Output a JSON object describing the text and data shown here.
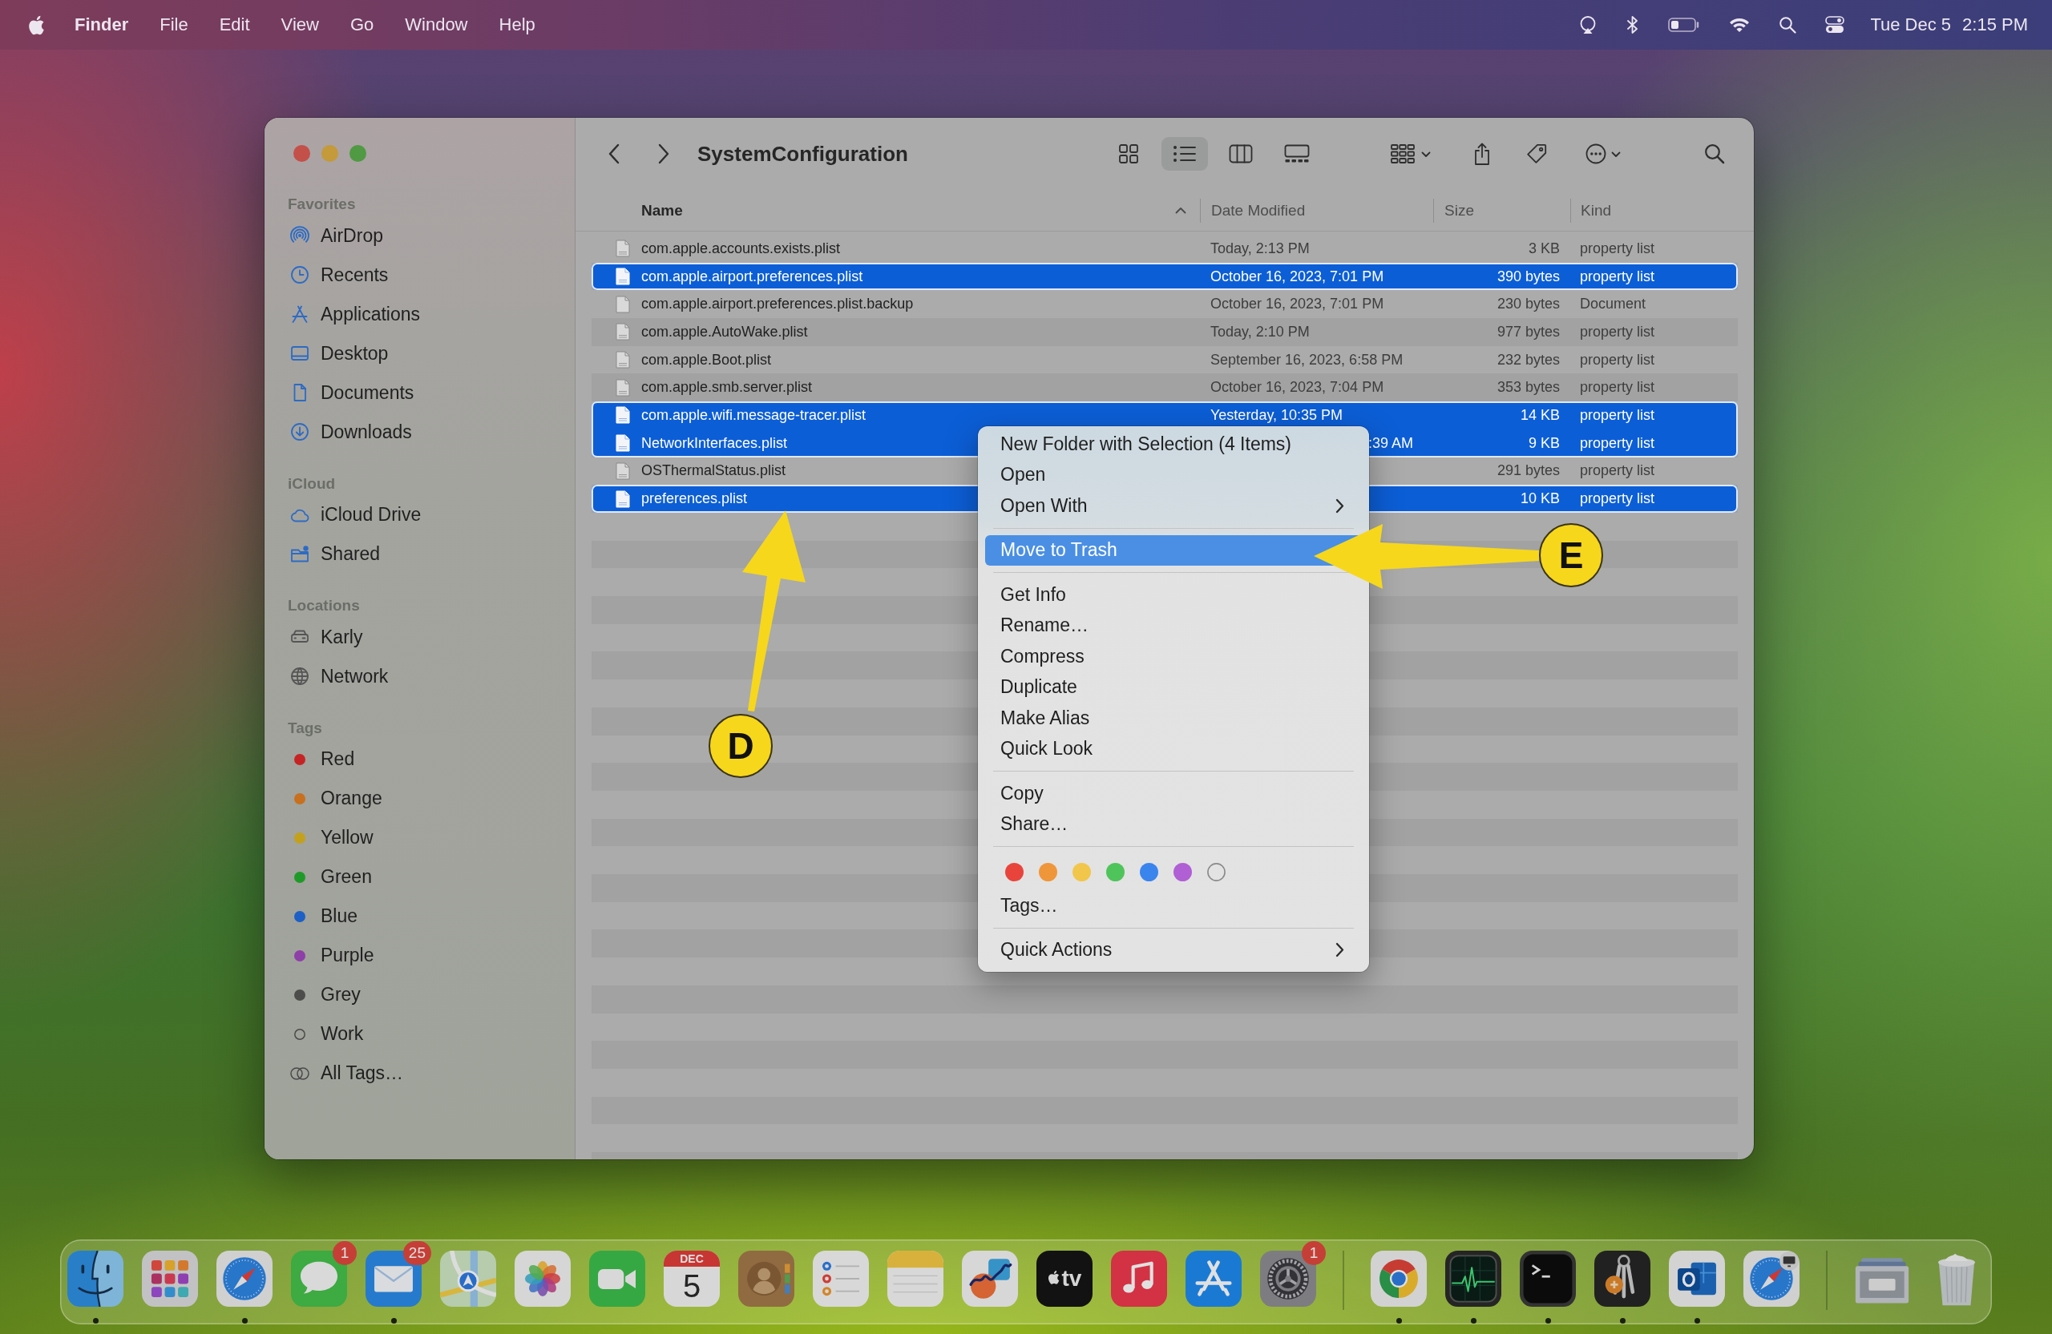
{
  "menu_bar": {
    "app_name": "Finder",
    "menus": [
      "File",
      "Edit",
      "View",
      "Go",
      "Window",
      "Help"
    ],
    "date": "Tue Dec 5",
    "time": "2:15 PM"
  },
  "window": {
    "title": "SystemConfiguration",
    "view_buttons": [
      {
        "kind": "icons",
        "selected": false
      },
      {
        "kind": "list",
        "selected": true
      },
      {
        "kind": "columns",
        "selected": false
      },
      {
        "kind": "gallery",
        "selected": false
      }
    ],
    "sidebar": [
      {
        "heading": "Favorites",
        "items": [
          {
            "label": "AirDrop"
          },
          {
            "label": "Recents"
          },
          {
            "label": "Applications"
          },
          {
            "label": "Desktop"
          },
          {
            "label": "Documents"
          },
          {
            "label": "Downloads"
          }
        ]
      },
      {
        "heading": "iCloud",
        "items": [
          {
            "label": "iCloud Drive"
          },
          {
            "label": "Shared"
          }
        ]
      },
      {
        "heading": "Locations",
        "items": [
          {
            "label": "Karly"
          },
          {
            "label": "Network"
          }
        ]
      },
      {
        "heading": "Tags",
        "items": [
          {
            "kind": "tag",
            "label": "Red",
            "color": "#c62424"
          },
          {
            "kind": "tag",
            "label": "Orange",
            "color": "#c8701e"
          },
          {
            "kind": "tag",
            "label": "Yellow",
            "color": "#c4a11c"
          },
          {
            "kind": "tag",
            "label": "Green",
            "color": "#1f9a28"
          },
          {
            "kind": "tag",
            "label": "Blue",
            "color": "#1d5fc6"
          },
          {
            "kind": "tag",
            "label": "Purple",
            "color": "#8e3fa8"
          },
          {
            "kind": "tag",
            "label": "Grey",
            "color": "#4d4d4b"
          },
          {
            "kind": "tag-empty",
            "label": "Work"
          },
          {
            "kind": "all-tags",
            "label": "All Tags…"
          }
        ]
      }
    ],
    "columns": [
      {
        "label": "Name",
        "sorted": true
      },
      {
        "label": "Date Modified",
        "sorted": false
      },
      {
        "label": "Size",
        "sorted": false
      },
      {
        "label": "Kind",
        "sorted": false
      }
    ],
    "rows": [
      {
        "kind": "plist",
        "name": "com.apple.accounts.exists.plist",
        "date": "Today, 2:13 PM",
        "size": "3 KB",
        "file_kind": "property list",
        "selected": false
      },
      {
        "kind": "plist",
        "name": "com.apple.airport.preferences.plist",
        "date": "October 16, 2023, 7:01 PM",
        "size": "390 bytes",
        "file_kind": "property list",
        "selected": true
      },
      {
        "kind": "blank",
        "name": "com.apple.airport.preferences.plist.backup",
        "date": "October 16, 2023, 7:01 PM",
        "size": "230 bytes",
        "file_kind": "Document",
        "selected": false
      },
      {
        "kind": "plist",
        "name": "com.apple.AutoWake.plist",
        "date": "Today, 2:10 PM",
        "size": "977 bytes",
        "file_kind": "property list",
        "selected": false
      },
      {
        "kind": "plist",
        "name": "com.apple.Boot.plist",
        "date": "September 16, 2023, 6:58 PM",
        "size": "232 bytes",
        "file_kind": "property list",
        "selected": false
      },
      {
        "kind": "plist",
        "name": "com.apple.smb.server.plist",
        "date": "October 16, 2023, 7:04 PM",
        "size": "353 bytes",
        "file_kind": "property list",
        "selected": false
      },
      {
        "kind": "plist",
        "name": "com.apple.wifi.message-tracer.plist",
        "date": "Yesterday, 10:35 PM",
        "size": "14 KB",
        "file_kind": "property list",
        "selected": true
      },
      {
        "kind": "plist",
        "name": "NetworkInterfaces.plist",
        "date": ":39 AM",
        "date_partial": true,
        "size": "9 KB",
        "file_kind": "property list",
        "selected": true
      },
      {
        "kind": "plist",
        "name": "OSThermalStatus.plist",
        "size": "291 bytes",
        "file_kind": "property list",
        "selected": false
      },
      {
        "kind": "plist",
        "name": "preferences.plist",
        "size": "10 KB",
        "file_kind": "property list",
        "selected": true
      }
    ]
  },
  "context_menu": {
    "groups": [
      [
        {
          "kind": "item",
          "label": "New Folder with Selection (4 Items)",
          "selected": false,
          "submenu": false
        },
        {
          "kind": "item",
          "label": "Open",
          "selected": false,
          "submenu": false
        },
        {
          "kind": "item",
          "label": "Open With",
          "selected": false,
          "submenu": true
        }
      ],
      [
        {
          "kind": "item",
          "label": "Move to Trash",
          "selected": true,
          "submenu": false
        }
      ],
      [
        {
          "kind": "item",
          "label": "Get Info",
          "selected": false,
          "submenu": false
        },
        {
          "kind": "item",
          "label": "Rename…",
          "selected": false,
          "submenu": false
        },
        {
          "kind": "item",
          "label": "Compress",
          "selected": false,
          "submenu": false
        },
        {
          "kind": "item",
          "label": "Duplicate",
          "selected": false,
          "submenu": false
        },
        {
          "kind": "item",
          "label": "Make Alias",
          "selected": false,
          "submenu": false
        },
        {
          "kind": "item",
          "label": "Quick Look",
          "selected": false,
          "submenu": false
        }
      ],
      [
        {
          "kind": "item",
          "label": "Copy",
          "selected": false,
          "submenu": false
        },
        {
          "kind": "item",
          "label": "Share…",
          "selected": false,
          "submenu": false
        }
      ],
      [
        {
          "kind": "swatches",
          "swatches": [
            {
              "kind": "color",
              "color": "#e8443c"
            },
            {
              "kind": "color",
              "color": "#f0963a"
            },
            {
              "kind": "color",
              "color": "#f2c64a"
            },
            {
              "kind": "color",
              "color": "#4fc45a"
            },
            {
              "kind": "color",
              "color": "#3a84ee"
            },
            {
              "kind": "color",
              "color": "#b05fd5"
            },
            {
              "kind": "clear"
            }
          ]
        },
        {
          "kind": "item",
          "label": "Tags…",
          "selected": false,
          "submenu": false
        }
      ],
      [
        {
          "kind": "item",
          "label": "Quick Actions",
          "selected": false,
          "submenu": true
        }
      ]
    ]
  },
  "annotations": [
    {
      "kind": "arrow-up",
      "label": "D"
    },
    {
      "kind": "arrow-left",
      "label": "E"
    }
  ],
  "dock": {
    "sections": [
      [
        {
          "running": true
        },
        {
          "running": false
        },
        {
          "running": true
        },
        {
          "running": false,
          "badge": "1"
        },
        {
          "running": true,
          "badge": "25"
        },
        {
          "running": false
        },
        {
          "running": false
        },
        {
          "running": false
        },
        {
          "running": false,
          "month": "DEC",
          "day": "5"
        },
        {
          "running": false
        },
        {
          "running": false
        },
        {
          "running": false
        },
        {
          "running": false
        },
        {
          "running": false,
          "logo_text": "tv"
        },
        {
          "running": false
        },
        {
          "running": false
        },
        {
          "running": false,
          "badge": "1"
        }
      ],
      [
        {
          "running": true
        },
        {
          "running": true
        },
        {
          "running": true
        },
        {
          "running": true
        },
        {
          "running": true
        },
        {
          "running": false
        }
      ],
      [
        {
          "running": false
        },
        {
          "running": false
        }
      ]
    ]
  }
}
